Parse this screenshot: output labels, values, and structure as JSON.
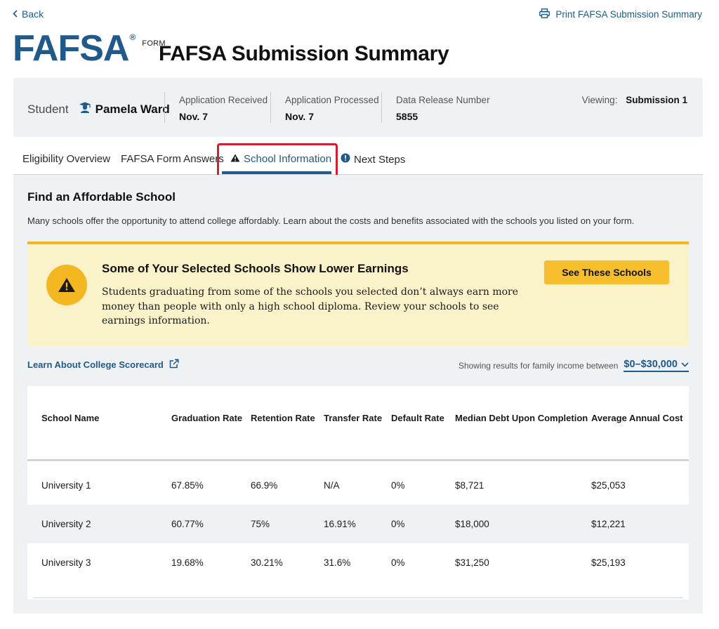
{
  "nav": {
    "back_label": "Back",
    "print_label": "Print FAFSA Submission Summary"
  },
  "logo": {
    "main": "FAFSA",
    "registered": "®",
    "form": "FORM"
  },
  "page_title": "FAFSA Submission Summary",
  "summary": {
    "student_label": "Student",
    "student_name": "Pamela Ward",
    "app_received_label": "Application Received",
    "app_received_value": "Nov. 7",
    "app_processed_label": "Application Processed",
    "app_processed_value": "Nov. 7",
    "drn_label": "Data Release Number",
    "drn_value": "5855",
    "viewing_label": "Viewing:",
    "viewing_value": "Submission 1"
  },
  "tabs": [
    {
      "label": "Eligibility Overview",
      "active": false
    },
    {
      "label": "FAFSA Form Answers",
      "active": false
    },
    {
      "label": "School Information",
      "active": true,
      "icon": "warning-icon"
    },
    {
      "label": "Next Steps",
      "active": false,
      "icon": "info-icon"
    }
  ],
  "section": {
    "title": "Find an Affordable School",
    "description": "Many schools offer the opportunity to attend college affordably. Learn about the costs and benefits associated with the schools you listed on your form."
  },
  "alert": {
    "title": "Some of Your Selected Schools Show Lower Earnings",
    "body": "Students graduating from some of the schools you selected don’t always earn more money than people with only a high school diploma. Review your schools to see earnings information.",
    "button_label": "See These Schools"
  },
  "scorecard_link": "Learn About College Scorecard",
  "income_filter": {
    "label": "Showing results for family income between",
    "value": "$0–$30,000"
  },
  "table": {
    "headers": [
      "School Name",
      "Graduation Rate",
      "Retention Rate",
      "Transfer Rate",
      "Default Rate",
      "Median Debt Upon Completion",
      "Average Annual Cost"
    ],
    "rows": [
      [
        "University 1",
        "67.85%",
        "66.9%",
        "N/A",
        "0%",
        "$8,721",
        "$25,053"
      ],
      [
        "University 2",
        "60.77%",
        "75%",
        "16.91%",
        "0%",
        "$18,000",
        "$12,221"
      ],
      [
        "University 3",
        "19.68%",
        "30.21%",
        "31.6%",
        "0%",
        "$31,250",
        "$25,193"
      ]
    ]
  },
  "colors": {
    "brand_blue": "#1f5a8a",
    "alert_yellow": "#f2b721",
    "alert_bg": "#faf2c8",
    "highlight_red": "#d0202f",
    "panel_bg": "#eef2f5"
  }
}
